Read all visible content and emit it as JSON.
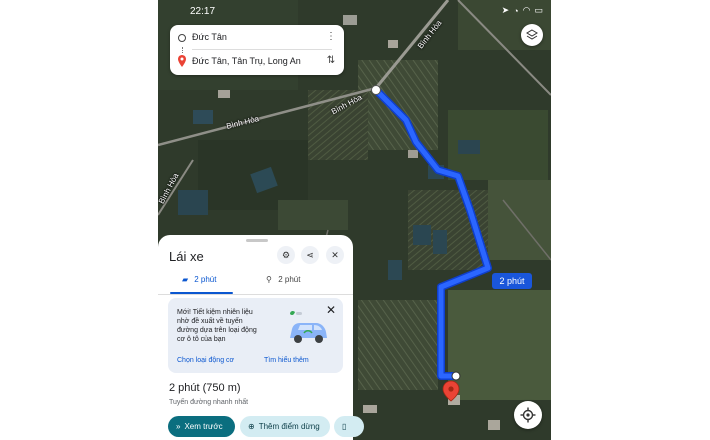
{
  "status_bar": {
    "time": "22:17",
    "indicators": [
      "photo-icon",
      "message-icon",
      "sync-icon",
      "location-icon",
      "bell-icon",
      "battery-icon",
      "wifi-icon",
      "signal-icon"
    ]
  },
  "directions": {
    "origin": "Đức Tân",
    "destination": "Đức Tân, Tân Trụ, Long An",
    "menu_icon": "more-vert-icon",
    "swap_icon": "swap-vertical-icon"
  },
  "map": {
    "road_labels": [
      "Bình Hòa",
      "Bình Hòa",
      "Bình Hòa",
      "Bình Hòa"
    ],
    "route_eta_label": "2 phút",
    "route_color": "#1a56ff",
    "destination_pin_color": "#ea4335"
  },
  "sheet": {
    "title": "Lái xe",
    "tabs": [
      {
        "label": "2 phút",
        "icon": "car-icon"
      },
      {
        "label": "2 phút",
        "icon": "motorbike-icon"
      }
    ],
    "info_card": {
      "lines": [
        "Mới! Tiết kiệm nhiên liệu",
        "nhờ đề xuất về tuyến",
        "đường dựa trên loại động",
        "cơ ô tô của bạn"
      ],
      "link_primary": "Chọn loại động cơ",
      "link_secondary": "Tìm hiểu thêm"
    },
    "duration": "2 phút (750 m)",
    "route_note": "Tuyến đường nhanh nhất",
    "buttons": {
      "preview": "Xem trước",
      "add_stop": "Thêm điểm dừng"
    }
  },
  "colors": {
    "accent": "#0b57d0",
    "primary_button": "#0b6e7f",
    "secondary_button": "#d3ecf2",
    "route": "#1a56ff"
  }
}
